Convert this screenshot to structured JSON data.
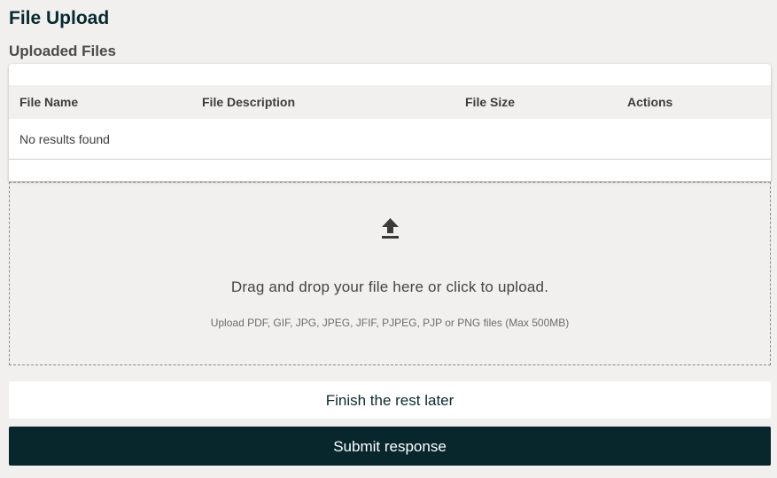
{
  "page": {
    "title": "File Upload",
    "section_title": "Uploaded Files"
  },
  "table": {
    "columns": [
      "File Name",
      "File Description",
      "File Size",
      "Actions"
    ],
    "empty_message": "No results found"
  },
  "dropzone": {
    "icon": "upload-icon",
    "instruction": "Drag and drop your file here or click to upload.",
    "hint": "Upload PDF, GIF, JPG, JPEG, JFIF, PJPEG, PJP or PNG files (Max 500MB)"
  },
  "actions": {
    "finish_later_label": "Finish the rest later",
    "submit_label": "Submit response"
  },
  "colors": {
    "background": "#f1f0ee",
    "primary": "#07272c",
    "header_row": "#f1f0ee"
  }
}
